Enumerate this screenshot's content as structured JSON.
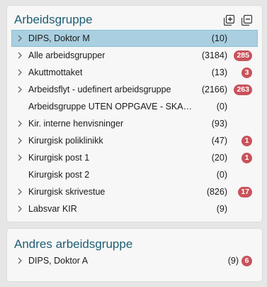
{
  "panel1": {
    "title": "Arbeidsgruppe",
    "expand_all_icon": "expand-all-icon",
    "collapse_all_icon": "collapse-all-icon",
    "items": [
      {
        "label": "DIPS, Doktor M",
        "count": "(10)",
        "badge": "",
        "chevron": true,
        "selected": true
      },
      {
        "label": "Alle arbeidsgrupper",
        "count": "(3184)",
        "badge": "285",
        "chevron": true
      },
      {
        "label": "Akuttmottaket",
        "count": "(13)",
        "badge": "3",
        "chevron": true
      },
      {
        "label": "Arbeidsflyt - udefinert arbeidsgruppe",
        "count": "(2166)",
        "badge": "263",
        "chevron": true
      },
      {
        "label": "Arbeidsgruppe UTEN OPPGAVE - SKAL v...",
        "count": "(0)",
        "badge": "",
        "chevron": false
      },
      {
        "label": "Kir. interne henvisninger",
        "count": "(93)",
        "badge": "",
        "chevron": true
      },
      {
        "label": "Kirurgisk poliklinikk",
        "count": "(47)",
        "badge": "1",
        "chevron": true
      },
      {
        "label": "Kirurgisk post 1",
        "count": "(20)",
        "badge": "1",
        "chevron": true
      },
      {
        "label": "Kirurgisk post 2",
        "count": "(0)",
        "badge": "",
        "chevron": false
      },
      {
        "label": "Kirurgisk skrivestue",
        "count": "(826)",
        "badge": "17",
        "chevron": true
      },
      {
        "label": "Labsvar KIR",
        "count": "(9)",
        "badge": "",
        "chevron": true
      }
    ]
  },
  "panel2": {
    "title": "Andres arbeidsgruppe",
    "items": [
      {
        "label": "DIPS, Doktor A",
        "count": "(9)",
        "badge": "6",
        "chevron": true
      }
    ]
  },
  "colors": {
    "title": "#1f5d73",
    "badge": "#c9525a",
    "selected": "#a9cfe0"
  }
}
